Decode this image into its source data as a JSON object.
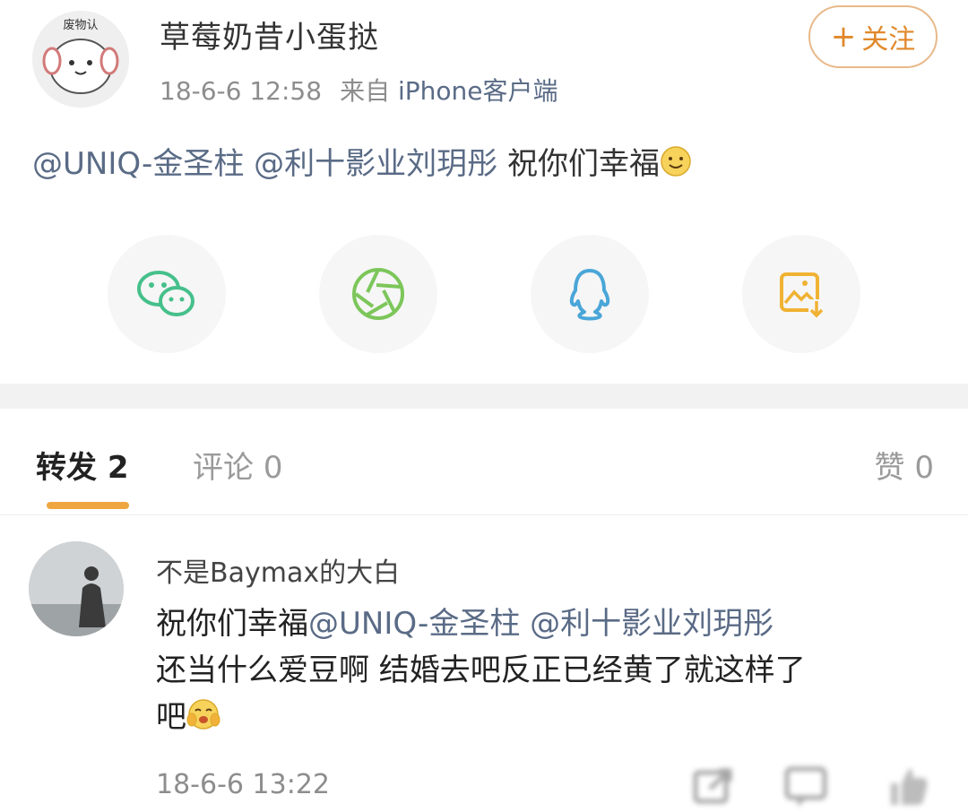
{
  "post": {
    "username": "草莓奶昔小蛋挞",
    "avatar_text": "废物认",
    "time": "18-6-6 12:58",
    "source_prefix": "来自",
    "source": "iPhone客户端",
    "follow_label": "关注",
    "mention1": "@UNIQ-金圣柱",
    "mention2": "@利十影业刘玥彤",
    "text": "祝你们幸福"
  },
  "share": [
    {
      "icon": "wechat-icon",
      "color": "#46c08b"
    },
    {
      "icon": "moments-icon",
      "color": "#7cc65a"
    },
    {
      "icon": "qq-icon",
      "color": "#4aa6d8"
    },
    {
      "icon": "save-image-icon",
      "color": "#f0b233"
    }
  ],
  "tabs": {
    "repost_label": "转发",
    "repost_count": "2",
    "comment_label": "评论",
    "comment_count": "0",
    "like_label": "赞",
    "like_count": "0"
  },
  "colors": {
    "accent": "#f0a640",
    "link": "#5a6b86"
  },
  "comment": {
    "username": "不是Baymax的大白",
    "text_prefix": "祝你们幸福",
    "mention1": "@UNIQ-金圣柱",
    "mention2": "@利十影业刘玥彤",
    "line2": "还当什么爱豆啊 结婚去吧反正已经黄了就这样了",
    "line3": "吧",
    "time": "18-6-6 13:22"
  }
}
